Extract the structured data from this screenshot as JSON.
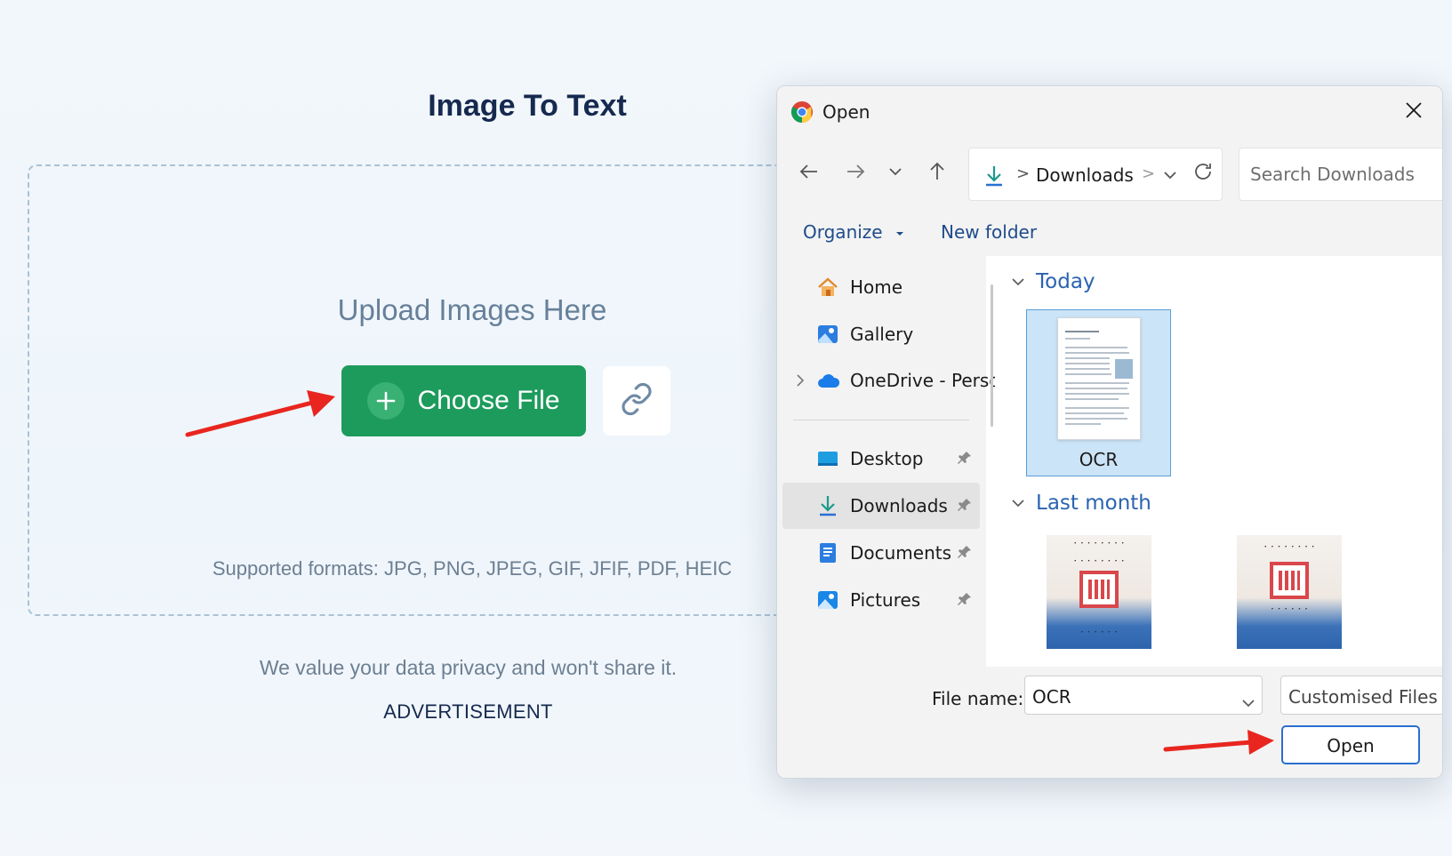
{
  "page": {
    "title": "Image To Text",
    "upload_heading": "Upload Images Here",
    "choose_file_label": "Choose File",
    "formats": "Supported formats: JPG, PNG, JPEG, GIF, JFIF, PDF, HEIC",
    "privacy": "We value your data privacy and won't share it.",
    "advertisement": "ADVERTISEMENT"
  },
  "dialog": {
    "title": "Open",
    "address": {
      "current_folder": "Downloads",
      "separator": ">"
    },
    "search_placeholder": "Search Downloads",
    "commands": {
      "organize": "Organize",
      "new_folder": "New folder"
    },
    "sidebar": {
      "items": [
        {
          "label": "Home",
          "icon": "home-icon"
        },
        {
          "label": "Gallery",
          "icon": "gallery-icon"
        },
        {
          "label": "OneDrive - Perso",
          "icon": "cloud-icon"
        },
        {
          "label": "Desktop",
          "icon": "desktop-icon",
          "pinned": true
        },
        {
          "label": "Downloads",
          "icon": "download-icon",
          "pinned": true,
          "selected": true
        },
        {
          "label": "Documents",
          "icon": "documents-icon",
          "pinned": true
        },
        {
          "label": "Pictures",
          "icon": "pictures-icon",
          "pinned": true
        }
      ]
    },
    "groups": [
      {
        "label": "Today",
        "files": [
          {
            "name": "OCR",
            "selected": true
          }
        ]
      },
      {
        "label": "Last month",
        "files": [
          {
            "name": ""
          },
          {
            "name": ""
          }
        ]
      }
    ],
    "footer": {
      "file_name_label": "File name:",
      "file_name_value": "OCR",
      "file_type_filter": "Customised Files",
      "open_button": "Open"
    }
  },
  "colors": {
    "choose_button": "#1d9b5c",
    "annotation_arrow": "#e8261f",
    "dialog_accent": "#2a6fd1"
  }
}
